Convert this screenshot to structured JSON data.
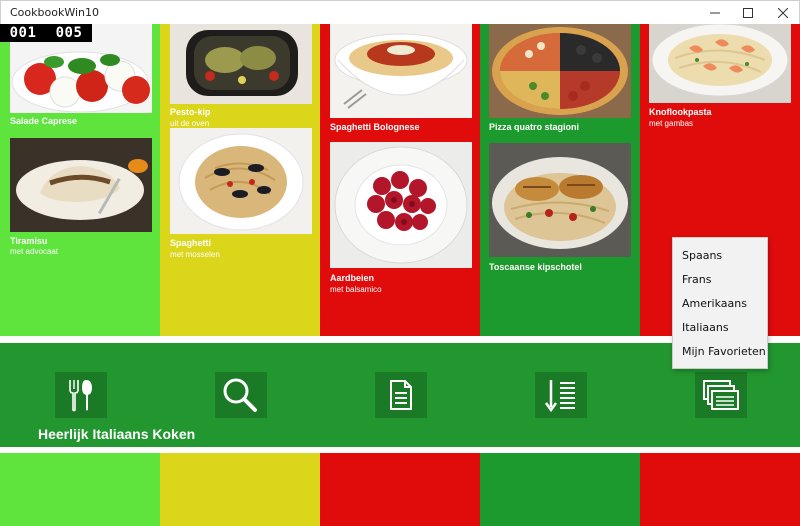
{
  "window": {
    "title": "CookbookWin10"
  },
  "counter": {
    "left": "001",
    "right": "005"
  },
  "colors": {
    "light_green": "#5ee43c",
    "yellow": "#dcd61b",
    "red": "#e00c0c",
    "dark_green": "#1d9a2e",
    "band": "#22962f"
  },
  "recipes": [
    {
      "name": "Salade Caprese",
      "sub": ""
    },
    {
      "name": "Tiramisu",
      "sub": "met advocaat"
    },
    {
      "name": "Pesto-kip",
      "sub": "uit de oven"
    },
    {
      "name": "Spaghetti",
      "sub": "met mosselen"
    },
    {
      "name": "Spaghetti Bolognese",
      "sub": ""
    },
    {
      "name": "Aardbeien",
      "sub": "met balsamico"
    },
    {
      "name": "Pizza quatro stagioni",
      "sub": ""
    },
    {
      "name": "Toscaanse kipschotel",
      "sub": ""
    },
    {
      "name": "Knoflookpasta",
      "sub": "met gambas"
    }
  ],
  "toolbar": {
    "title": "Heerlijk Italiaans Koken",
    "buttons": [
      {
        "icon": "cutlery-icon"
      },
      {
        "icon": "search-icon"
      },
      {
        "icon": "document-icon"
      },
      {
        "icon": "sort-list-icon"
      },
      {
        "icon": "stacked-cards-icon"
      }
    ]
  },
  "cuisine_menu": {
    "items": [
      "Spaans",
      "Frans",
      "Amerikaans",
      "Italiaans",
      "Mijn Favorieten"
    ]
  }
}
